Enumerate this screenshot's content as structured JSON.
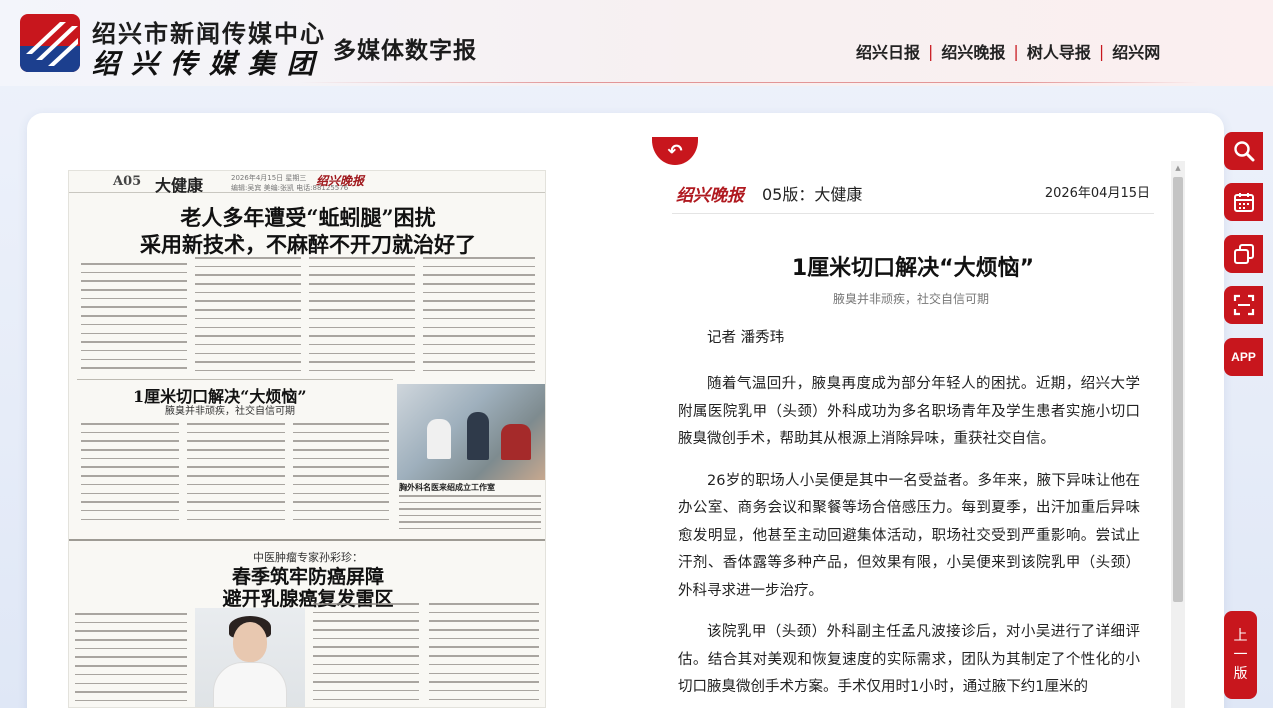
{
  "header": {
    "org_name": "绍兴市新闻传媒中心",
    "group_name": "绍兴传媒集团",
    "digital_title": "多媒体数字报",
    "links": [
      {
        "label": "绍兴日报"
      },
      {
        "label": "绍兴晚报"
      },
      {
        "label": "树人导报"
      },
      {
        "label": "绍兴网"
      }
    ],
    "separator": "|"
  },
  "back_button": {
    "icon": "back-arrow-icon",
    "glyph": "↶"
  },
  "newspaper": {
    "section_no": "A05",
    "section_name": "大健康",
    "masthead": "绍兴晚报",
    "meta_line1": "2026年4月15日  星期三",
    "meta_line2": "编辑:吴宾  美编:张凯  电话:88125576",
    "headline1_line1": "老人多年遭受“蚯蚓腿”困扰",
    "headline1_line2": "采用新技术，不麻醉不开刀就治好了",
    "headline2": "1厘米切口解决“大烦恼”",
    "headline2_sub": "腋臭并非顽疾，社交自信可期",
    "photo_caption": "胸外科名医来绍成立工作室",
    "section2_lede": "中医肿瘤专家孙彩珍：",
    "headline3_line1": "春季筑牢防癌屏障",
    "headline3_line2": "避开乳腺癌复发雷区"
  },
  "article": {
    "masthead": "绍兴晚报",
    "edition": "05版：大健康",
    "date": "2026年04月15日",
    "title": "1厘米切口解决“大烦恼”",
    "subtitle": "腋臭并非顽疾，社交自信可期",
    "reporter": "记者 潘秀玮",
    "paragraphs": [
      "随着气温回升，腋臭再度成为部分年轻人的困扰。近期，绍兴大学附属医院乳甲（头颈）外科成功为多名职场青年及学生患者实施小切口腋臭微创手术，帮助其从根源上消除异味，重获社交自信。",
      "26岁的职场人小吴便是其中一名受益者。多年来，腋下异味让他在办公室、商务会议和聚餐等场合倍感压力。每到夏季，出汗加重后异味愈发明显，他甚至主动回避集体活动，职场社交受到严重影响。尝试止汗剂、香体露等多种产品，但效果有限，小吴便来到该院乳甲（头颈）外科寻求进一步治疗。",
      "该院乳甲（头颈）外科副主任孟凡波接诊后，对小吴进行了详细评估。结合其对美观和恢复速度的实际需求，团队为其制定了个性化的小切口腋臭微创手术方案。手术仅用时1小时，通过腋下约1厘米的"
    ]
  },
  "toolbar": [
    {
      "name": "search-tool",
      "icon": "search-icon"
    },
    {
      "name": "calendar-tool",
      "icon": "calendar-icon"
    },
    {
      "name": "copy-tool",
      "icon": "copy-icon"
    },
    {
      "name": "scan-tool",
      "icon": "scan-icon"
    },
    {
      "name": "app-tool",
      "icon": "app-icon",
      "label": "APP"
    }
  ],
  "prev_edition": {
    "label_chars": [
      "上",
      "一",
      "版"
    ]
  },
  "colors": {
    "accent": "#c8161d",
    "brand_blue": "#1c3f8e",
    "panel_bg": "#ffffff",
    "page_bg": "#e6ecf8"
  }
}
